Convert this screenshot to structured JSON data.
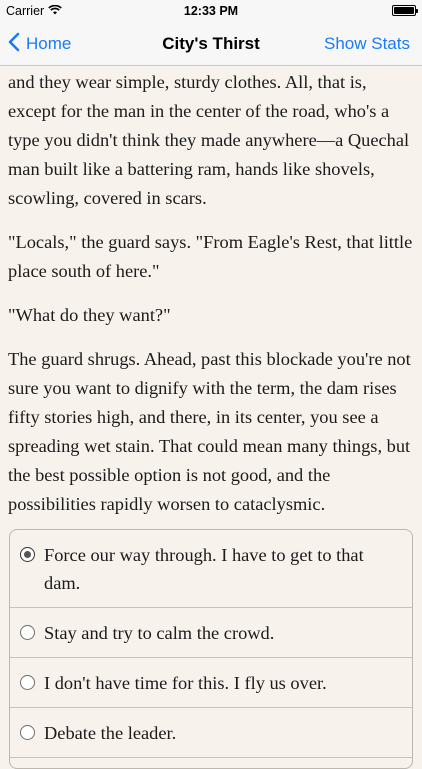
{
  "status_bar": {
    "carrier": "Carrier",
    "time": "12:33 PM",
    "wifi_icon": "wifi-icon",
    "battery_icon": "battery-icon"
  },
  "nav": {
    "back_label": "Home",
    "back_icon": "chevron-left-icon",
    "title": "City's Thirst",
    "right_label": "Show Stats",
    "accent": "#1a7cf5"
  },
  "story": {
    "paragraphs": [
      "and they wear simple, sturdy clothes. All, that is, except for the man in the center of the road, who's a type you didn't think they made anywhere—a Quechal man built like a battering ram, hands like shovels, scowling, covered in scars.",
      "\"Locals,\" the guard says. \"From Eagle's Rest, that little place south of here.\"",
      "\"What do they want?\"",
      "The guard shrugs. Ahead, past this blockade you're not sure you want to dignify with the term, the dam rises fifty stories high, and there, in its center, you see a spreading wet stain. That could mean many things, but the best possible option is not good, and the possibilities rapidly worsen to cataclysmic."
    ]
  },
  "choices": [
    {
      "label": "Force our way through. I have to get to that dam.",
      "selected": true
    },
    {
      "label": "Stay and try to calm the crowd.",
      "selected": false
    },
    {
      "label": "I don't have time for this. I fly us over.",
      "selected": false
    },
    {
      "label": "Debate the leader.",
      "selected": false
    }
  ]
}
